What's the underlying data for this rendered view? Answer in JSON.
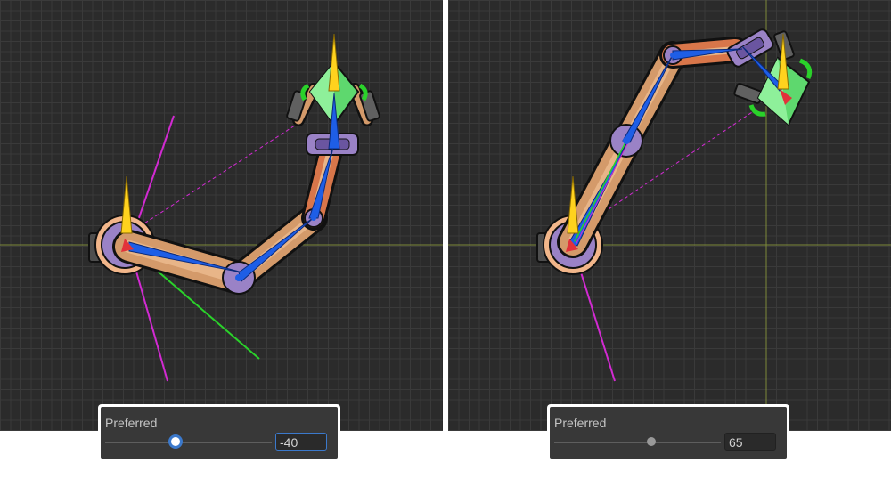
{
  "panels": [
    {
      "label": "Preferred",
      "value": "-40",
      "focused": true
    },
    {
      "label": "Preferred",
      "value": "65",
      "focused": false
    }
  ],
  "colors": {
    "grid_bg": "#2b2b2b",
    "bone": "#1e5ee6",
    "limit_line": "#d22ad2",
    "preferred_line": "#2ad22a",
    "gizmo_arrow": "#ffd21e",
    "limb": "#d49a6a",
    "joint": "#9a82c6",
    "gem": "#5ed86e",
    "focus_ring": "#3b79cc"
  },
  "icons": [
    "yellow-arrow-icon",
    "red-arrow-icon",
    "slider-thumb-icon"
  ]
}
